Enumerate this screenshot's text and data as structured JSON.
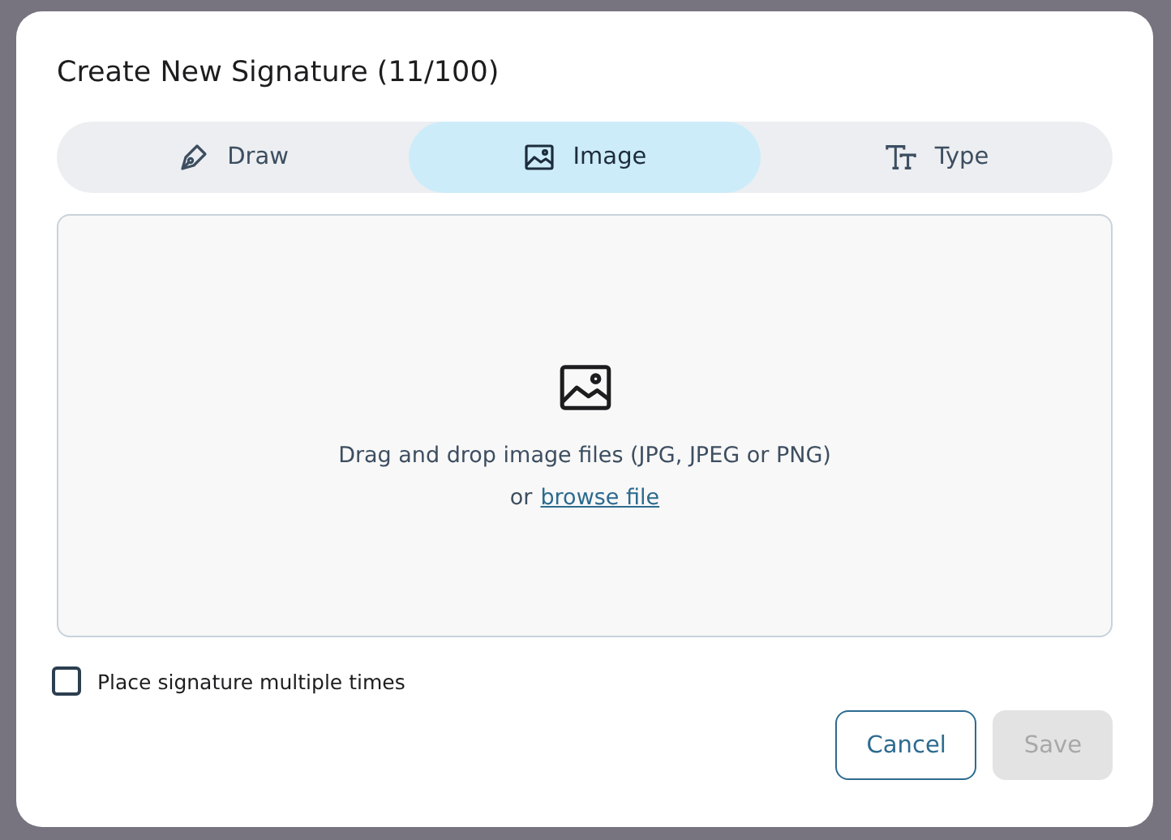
{
  "dialog": {
    "title": "Create New Signature (11/100)",
    "tabs": [
      {
        "kind": "draw",
        "label": "Draw",
        "selected": false
      },
      {
        "kind": "image",
        "label": "Image",
        "selected": true
      },
      {
        "kind": "type",
        "label": "Type",
        "selected": false
      }
    ],
    "dropzone": {
      "instruction": "Drag and drop image files (JPG, JPEG or PNG)",
      "prefix": "or",
      "link": "browse file"
    },
    "option": {
      "label": "Place signature multiple times",
      "checked": false
    },
    "buttons": [
      {
        "kind": "secondary",
        "label": "Cancel",
        "disabled": false
      },
      {
        "kind": "primary",
        "label": "Save",
        "disabled": true
      }
    ]
  }
}
